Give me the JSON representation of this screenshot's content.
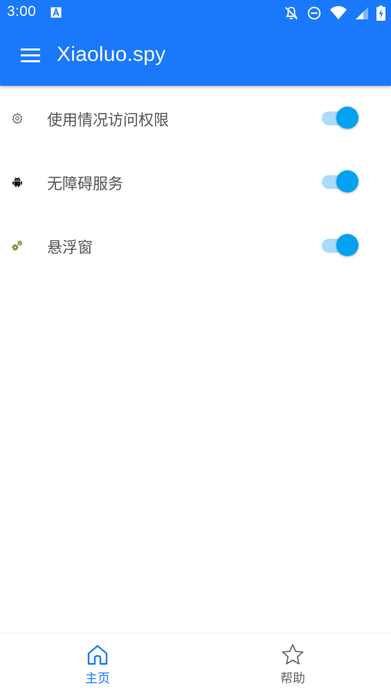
{
  "status_bar": {
    "time": "3:00",
    "icons": [
      "text-a-icon",
      "notifications-off-icon",
      "do-not-disturb-icon",
      "wifi-icon",
      "cellular-signal-icon",
      "battery-charging-icon"
    ]
  },
  "toolbar": {
    "menu_icon": "hamburger-menu-icon",
    "title": "Xiaoluo.spy",
    "background_color": "#1a79fb"
  },
  "permissions": [
    {
      "label": "使用情况访问权限",
      "icon": "gear-outline-icon",
      "enabled": true
    },
    {
      "label": "无障碍服务",
      "icon": "android-robot-icon",
      "enabled": true
    },
    {
      "label": "悬浮窗",
      "icon": "gears-icon",
      "enabled": true
    }
  ],
  "switch_colors": {
    "thumb": "#03a1f2",
    "track": "#a9dcf9"
  },
  "bottom_nav": [
    {
      "label": "主页",
      "icon": "home-icon",
      "selected": true,
      "color": "#1a79fb"
    },
    {
      "label": "帮助",
      "icon": "star-outline-icon",
      "selected": false,
      "color": "#666666"
    }
  ]
}
